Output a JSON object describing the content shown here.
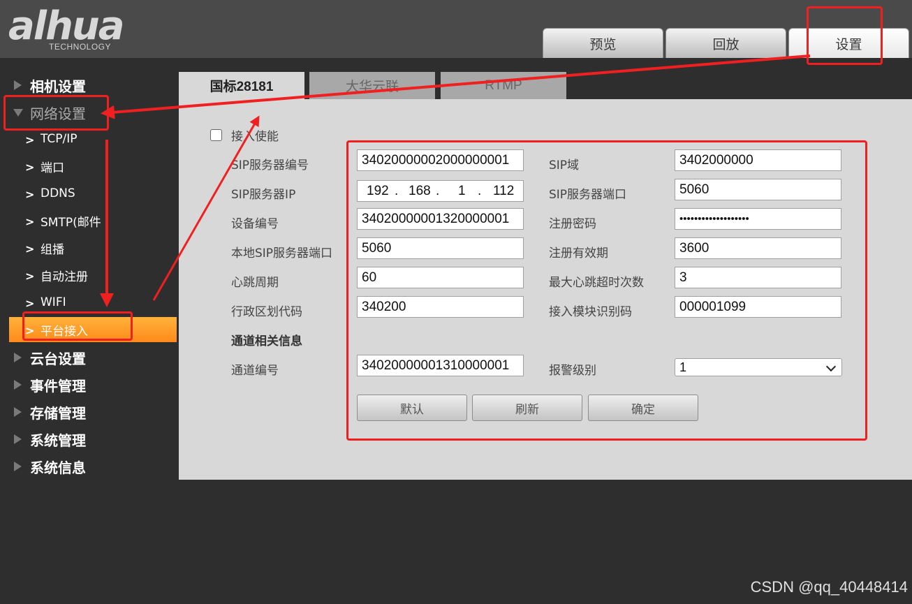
{
  "header": {
    "logo_text": "alhua",
    "logo_sub": "TECHNOLOGY",
    "tabs": [
      {
        "label": "预览"
      },
      {
        "label": "回放"
      },
      {
        "label": "设置"
      }
    ]
  },
  "sidebar": {
    "sections": [
      {
        "label": "相机设置"
      },
      {
        "label": "网络设置"
      },
      {
        "label": "云台设置"
      },
      {
        "label": "事件管理"
      },
      {
        "label": "存储管理"
      },
      {
        "label": "系统管理"
      },
      {
        "label": "系统信息"
      }
    ],
    "network_items": [
      {
        "label": "TCP/IP"
      },
      {
        "label": "端口"
      },
      {
        "label": "DDNS"
      },
      {
        "label": "SMTP(邮件"
      },
      {
        "label": "组播"
      },
      {
        "label": "自动注册"
      },
      {
        "label": "WIFI"
      },
      {
        "label": "平台接入"
      }
    ]
  },
  "subtabs": [
    {
      "label": "国标28181"
    },
    {
      "label": "大华云联"
    },
    {
      "label": "RTMP"
    }
  ],
  "form": {
    "enable_label": "接入使能",
    "sip_server_id": {
      "label": "SIP服务器编号",
      "value": "34020000002000000001"
    },
    "sip_domain": {
      "label": "SIP域",
      "value": "3402000000"
    },
    "sip_server_ip": {
      "label": "SIP服务器IP",
      "octets": [
        "192",
        "168",
        "1",
        "112"
      ]
    },
    "sip_server_port": {
      "label": "SIP服务器端口",
      "value": "5060"
    },
    "device_id": {
      "label": "设备编号",
      "value": "34020000001320000001"
    },
    "register_password": {
      "label": "注册密码",
      "value": "•••••••••••••••••••"
    },
    "local_sip_port": {
      "label": "本地SIP服务器端口",
      "value": "5060"
    },
    "register_validity": {
      "label": "注册有效期",
      "value": "3600"
    },
    "heartbeat_period": {
      "label": "心跳周期",
      "value": "60"
    },
    "max_heartbeat_timeout": {
      "label": "最大心跳超时次数",
      "value": "3"
    },
    "region_code": {
      "label": "行政区划代码",
      "value": "340200"
    },
    "module_id": {
      "label": "接入模块识别码",
      "value": "000001099"
    },
    "channel_section_title": "通道相关信息",
    "channel_id": {
      "label": "通道编号",
      "value": "34020000001310000001"
    },
    "alarm_level": {
      "label": "报警级别",
      "value": "1"
    }
  },
  "buttons": {
    "default": "默认",
    "refresh": "刷新",
    "confirm": "确定"
  },
  "watermark": "CSDN @qq_40448414",
  "colors": {
    "accent": "#ff9a2a",
    "annotation": "#f02020"
  }
}
